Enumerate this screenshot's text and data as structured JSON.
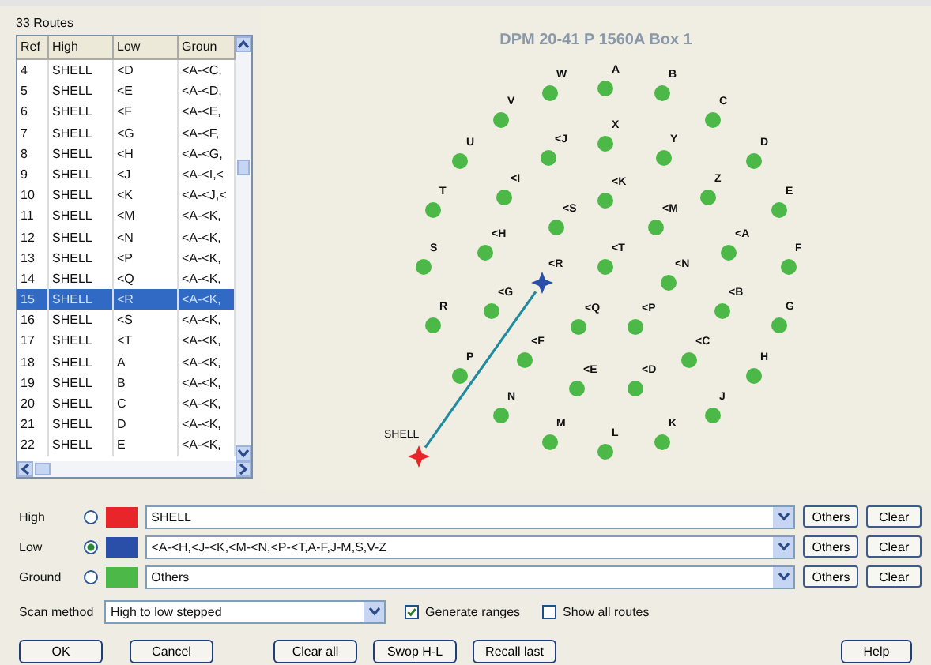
{
  "routes_list": {
    "title": "33 Routes",
    "columns": [
      "Ref",
      "High",
      "Low",
      "Groun"
    ],
    "rows": [
      {
        "cells": [
          "4",
          "SHELL",
          "<D",
          "<A-<C,"
        ],
        "selected": false
      },
      {
        "cells": [
          "5",
          "SHELL",
          "<E",
          "<A-<D,"
        ],
        "selected": false
      },
      {
        "cells": [
          "6",
          "SHELL",
          "<F",
          "<A-<E,"
        ],
        "selected": false
      },
      {
        "cells": [
          "7",
          "SHELL",
          "<G",
          "<A-<F,"
        ],
        "selected": false
      },
      {
        "cells": [
          "8",
          "SHELL",
          "<H",
          "<A-<G,"
        ],
        "selected": false
      },
      {
        "cells": [
          "9",
          "SHELL",
          "<J",
          "<A-<I,<"
        ],
        "selected": false
      },
      {
        "cells": [
          "10",
          "SHELL",
          "<K",
          "<A-<J,<"
        ],
        "selected": false
      },
      {
        "cells": [
          "11",
          "SHELL",
          "<M",
          "<A-<K,"
        ],
        "selected": false
      },
      {
        "cells": [
          "12",
          "SHELL",
          "<N",
          "<A-<K,"
        ],
        "selected": false
      },
      {
        "cells": [
          "13",
          "SHELL",
          "<P",
          "<A-<K,"
        ],
        "selected": false
      },
      {
        "cells": [
          "14",
          "SHELL",
          "<Q",
          "<A-<K,"
        ],
        "selected": false
      },
      {
        "cells": [
          "15",
          "SHELL",
          "<R",
          "<A-<K,"
        ],
        "selected": true
      },
      {
        "cells": [
          "16",
          "SHELL",
          "<S",
          "<A-<K,"
        ],
        "selected": false
      },
      {
        "cells": [
          "17",
          "SHELL",
          "<T",
          "<A-<K,"
        ],
        "selected": false
      },
      {
        "cells": [
          "18",
          "SHELL",
          "A",
          "<A-<K,"
        ],
        "selected": false
      },
      {
        "cells": [
          "19",
          "SHELL",
          "B",
          "<A-<K,"
        ],
        "selected": false
      },
      {
        "cells": [
          "20",
          "SHELL",
          "C",
          "<A-<K,"
        ],
        "selected": false
      },
      {
        "cells": [
          "21",
          "SHELL",
          "D",
          "<A-<K,"
        ],
        "selected": false
      },
      {
        "cells": [
          "22",
          "SHELL",
          "E",
          "<A-<K,"
        ],
        "selected": false
      }
    ]
  },
  "diagram": {
    "title": "DPM 20-41 P 1560A Box 1",
    "pins": [
      {
        "label": "W",
        "kind": "ground",
        "color": "#4cb848"
      },
      {
        "label": "A",
        "kind": "ground",
        "color": "#4cb848"
      },
      {
        "label": "B",
        "kind": "ground",
        "color": "#4cb848"
      },
      {
        "label": "V",
        "kind": "ground",
        "color": "#4cb848"
      },
      {
        "label": "C",
        "kind": "ground",
        "color": "#4cb848"
      },
      {
        "label": "<J",
        "kind": "ground",
        "color": "#4cb848"
      },
      {
        "label": "X",
        "kind": "ground",
        "color": "#4cb848"
      },
      {
        "label": "Y",
        "kind": "ground",
        "color": "#4cb848"
      },
      {
        "label": "U",
        "kind": "ground",
        "color": "#4cb848"
      },
      {
        "label": "D",
        "kind": "ground",
        "color": "#4cb848"
      },
      {
        "label": "<I",
        "kind": "ground",
        "color": "#4cb848"
      },
      {
        "label": "<K",
        "kind": "ground",
        "color": "#4cb848"
      },
      {
        "label": "Z",
        "kind": "ground",
        "color": "#4cb848"
      },
      {
        "label": "T",
        "kind": "ground",
        "color": "#4cb848"
      },
      {
        "label": "E",
        "kind": "ground",
        "color": "#4cb848"
      },
      {
        "label": "<S",
        "kind": "ground",
        "color": "#4cb848"
      },
      {
        "label": "<M",
        "kind": "ground",
        "color": "#4cb848"
      },
      {
        "label": "<H",
        "kind": "ground",
        "color": "#4cb848"
      },
      {
        "label": "<A",
        "kind": "ground",
        "color": "#4cb848"
      },
      {
        "label": "S",
        "kind": "ground",
        "color": "#4cb848"
      },
      {
        "label": "<T",
        "kind": "ground",
        "color": "#4cb848"
      },
      {
        "label": "F",
        "kind": "ground",
        "color": "#4cb848"
      },
      {
        "label": "<R",
        "kind": "low",
        "color": "#2a4fa8"
      },
      {
        "label": "<N",
        "kind": "ground",
        "color": "#4cb848"
      },
      {
        "label": "<G",
        "kind": "ground",
        "color": "#4cb848"
      },
      {
        "label": "<B",
        "kind": "ground",
        "color": "#4cb848"
      },
      {
        "label": "R",
        "kind": "ground",
        "color": "#4cb848"
      },
      {
        "label": "<Q",
        "kind": "ground",
        "color": "#4cb848"
      },
      {
        "label": "<P",
        "kind": "ground",
        "color": "#4cb848"
      },
      {
        "label": "G",
        "kind": "ground",
        "color": "#4cb848"
      },
      {
        "label": "<F",
        "kind": "ground",
        "color": "#4cb848"
      },
      {
        "label": "<C",
        "kind": "ground",
        "color": "#4cb848"
      },
      {
        "label": "P",
        "kind": "ground",
        "color": "#4cb848"
      },
      {
        "label": "H",
        "kind": "ground",
        "color": "#4cb848"
      },
      {
        "label": "<E",
        "kind": "ground",
        "color": "#4cb848"
      },
      {
        "label": "<D",
        "kind": "ground",
        "color": "#4cb848"
      },
      {
        "label": "N",
        "kind": "ground",
        "color": "#4cb848"
      },
      {
        "label": "J",
        "kind": "ground",
        "color": "#4cb848"
      },
      {
        "label": "M",
        "kind": "ground",
        "color": "#4cb848"
      },
      {
        "label": "K",
        "kind": "ground",
        "color": "#4cb848"
      },
      {
        "label": "L",
        "kind": "ground",
        "color": "#4cb848"
      },
      {
        "label": "SHELL",
        "kind": "high",
        "color": "#e8262a"
      }
    ]
  },
  "assignments": [
    {
      "label": "High",
      "selected": false,
      "color": "#e8262a",
      "value": "SHELL",
      "buttons": [
        "Others",
        "Clear"
      ]
    },
    {
      "label": "Low",
      "selected": true,
      "color": "#2a4fa8",
      "value": "<A-<H,<J-<K,<M-<N,<P-<T,A-F,J-M,S,V-Z",
      "buttons": [
        "Others",
        "Clear"
      ]
    },
    {
      "label": "Ground",
      "selected": false,
      "color": "#4cb848",
      "value": "Others",
      "buttons": [
        "Others",
        "Clear"
      ]
    }
  ],
  "scan_method": {
    "label": "Scan method",
    "value": "High to low stepped"
  },
  "options": [
    {
      "label": "Generate ranges",
      "checked": true
    },
    {
      "label": "Show all routes",
      "checked": false
    }
  ],
  "buttons": [
    "OK",
    "Cancel",
    "Clear all",
    "Swop H-L",
    "Recall last",
    "Help"
  ]
}
